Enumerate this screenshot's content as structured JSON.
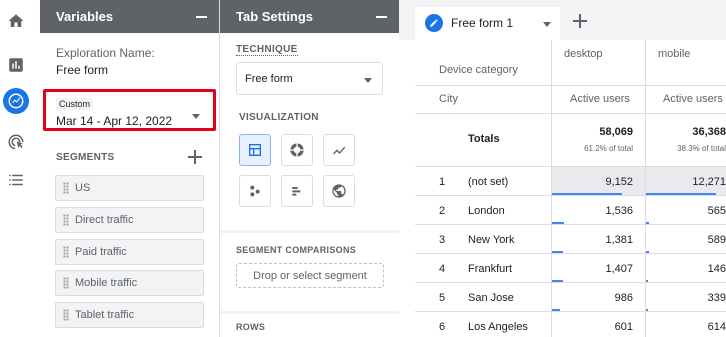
{
  "nav": {
    "icons": [
      "home-icon",
      "reports-icon",
      "explore-icon",
      "advertising-icon",
      "configure-icon"
    ]
  },
  "variables_panel": {
    "title": "Variables",
    "exploration_name_label": "Exploration Name:",
    "exploration_name_value": "Free form",
    "date_tag": "Custom",
    "date_range": "Mar 14 - Apr 12, 2022",
    "segments_title": "SEGMENTS",
    "segments": [
      "US",
      "Direct traffic",
      "Paid traffic",
      "Mobile traffic",
      "Tablet traffic"
    ]
  },
  "tab_settings_panel": {
    "title": "Tab Settings",
    "technique_title": "TECHNIQUE",
    "technique_value": "Free form",
    "visualization_title": "VISUALIZATION",
    "visualization_options": [
      "table-icon",
      "donut-chart-icon",
      "line-chart-icon",
      "scatter-plot-icon",
      "bar-chart-icon",
      "geo-map-icon"
    ],
    "segment_comparisons_title": "SEGMENT COMPARISONS",
    "segment_drop_label": "Drop or select segment",
    "rows_title": "ROWS"
  },
  "report": {
    "tab_label": "Free form 1",
    "dimension_label": "Device category",
    "row_dimension_label": "City",
    "columns": [
      {
        "device": "desktop",
        "metric": "Active users",
        "total": "58,069",
        "total_pct": "61.2% of total"
      },
      {
        "device": "mobile",
        "metric": "Active users",
        "total": "36,368",
        "total_pct": "38.3% of total"
      }
    ],
    "totals_label": "Totals",
    "rows": [
      {
        "idx": "1",
        "city": "(not set)",
        "desktop": "9,152",
        "mobile": "12,271"
      },
      {
        "idx": "2",
        "city": "London",
        "desktop": "1,536",
        "mobile": "565"
      },
      {
        "idx": "3",
        "city": "New York",
        "desktop": "1,381",
        "mobile": "589"
      },
      {
        "idx": "4",
        "city": "Frankfurt",
        "desktop": "1,407",
        "mobile": "146"
      },
      {
        "idx": "5",
        "city": "San Jose",
        "desktop": "986",
        "mobile": "339"
      },
      {
        "idx": "6",
        "city": "Los Angeles",
        "desktop": "601",
        "mobile": "614"
      }
    ]
  },
  "colors": {
    "accent": "#1a73e8",
    "highlight_border": "#e3001b",
    "panel_header": "#5f6368"
  }
}
